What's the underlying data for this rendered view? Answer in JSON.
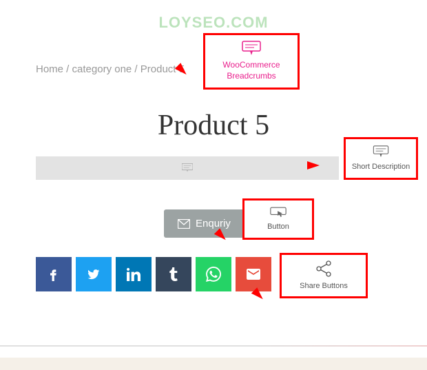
{
  "watermark": "LOYSEO.COM",
  "breadcrumb": {
    "home": "Home",
    "sep": " / ",
    "category": "category one",
    "product": "Product 5"
  },
  "page_title": "Product 5",
  "enquiry_label": "Enquriy",
  "callouts": {
    "breadcrumbs": "WooCommerce Breadcrumbs",
    "short_desc": "Short Description",
    "button": "Button",
    "share": "Share Buttons"
  },
  "share": {
    "facebook": "facebook",
    "twitter": "twitter",
    "linkedin": "linkedin",
    "tumblr": "tumblr",
    "whatsapp": "whatsapp",
    "email": "email"
  }
}
